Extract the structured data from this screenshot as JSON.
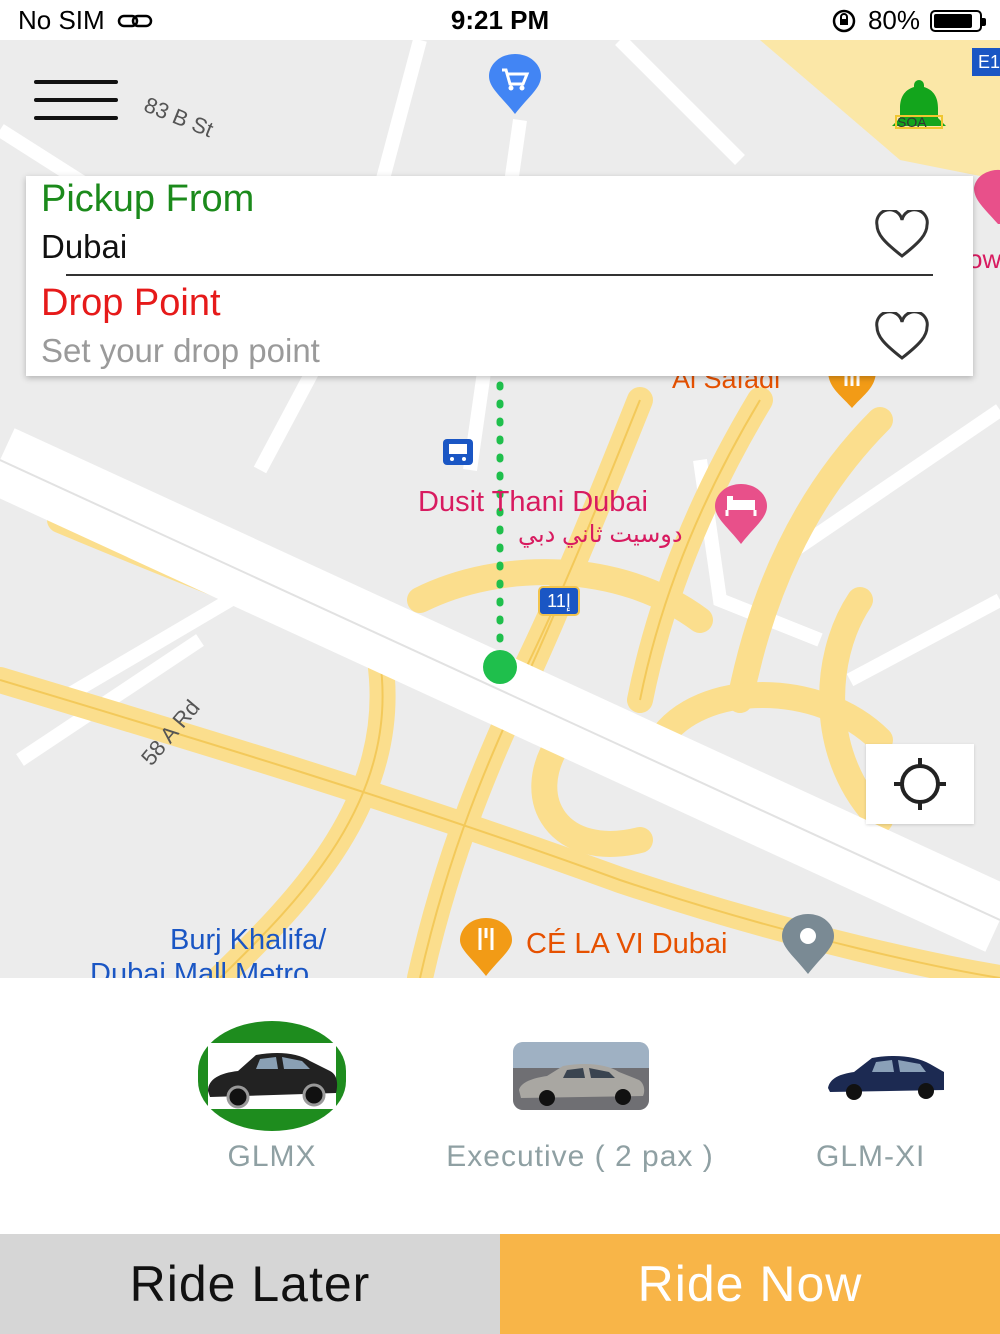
{
  "status_bar": {
    "carrier": "No SIM",
    "time": "9:21 PM",
    "battery": "80%",
    "battery_level": 0.8
  },
  "map": {
    "labels": {
      "street_83b": "83 B St",
      "street_58a": "58 A Rd",
      "al_safadi": "Al Safadi",
      "dusit_en": "Dusit Thani Dubai",
      "dusit_ar": "دوسيت ثاني دبي",
      "metro_line1": "Burj Khalifa/",
      "metro_line2": "Dubai Mall Metro",
      "cela_vi": "CÉ LA VI Dubai",
      "route_shield": "11إ",
      "shield_e11": "E1",
      "edge_label": "ow",
      "bell_badge": "SOA"
    }
  },
  "location_card": {
    "pickup_title": "Pickup From",
    "pickup_value": "Dubai",
    "drop_title": "Drop Point",
    "drop_placeholder": "Set your drop point"
  },
  "vehicles": [
    {
      "label": "GLMX",
      "selected": true
    },
    {
      "label": "Executive ( 2 pax )",
      "selected": false
    },
    {
      "label": "GLM-XI",
      "selected": false
    }
  ],
  "buttons": {
    "ride_later": "Ride Later",
    "ride_now": "Ride Now"
  },
  "colors": {
    "pickup": "#1b8a1b",
    "drop": "#e61a1a",
    "ride_now": "#f8b548",
    "ride_later": "#d6d6d6",
    "selected_vehicle": "#1e8c1e"
  }
}
